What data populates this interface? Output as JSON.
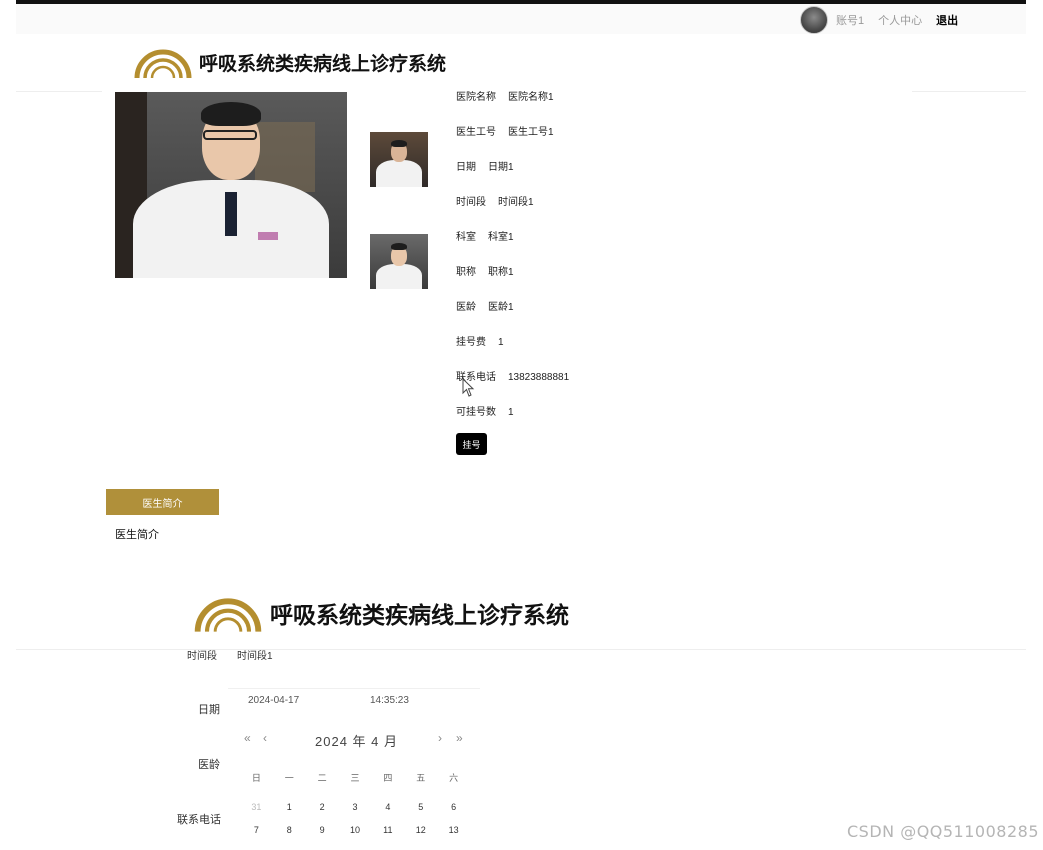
{
  "header": {
    "account": "账号1",
    "profile_link": "个人中心",
    "logout": "退出"
  },
  "brand": {
    "title": "呼吸系统类疾病线上诊疗系统"
  },
  "doctor_info": {
    "rows": [
      {
        "label": "医院名称",
        "value": "医院名称1"
      },
      {
        "label": "医生工号",
        "value": "医生工号1"
      },
      {
        "label": "日期",
        "value": "日期1"
      },
      {
        "label": "时间段",
        "value": "时间段1"
      },
      {
        "label": "科室",
        "value": "科室1"
      },
      {
        "label": "职称",
        "value": "职称1"
      },
      {
        "label": "医龄",
        "value": "医龄1"
      },
      {
        "label": "挂号费",
        "value": "1"
      },
      {
        "label": "联系电话",
        "value": "13823888881"
      },
      {
        "label": "可挂号数",
        "value": "1"
      }
    ],
    "register_button": "挂号"
  },
  "intro": {
    "tab_label": "医生简介",
    "content": "医生简介"
  },
  "form": {
    "timeslot_label": "时间段",
    "timeslot_value": "时间段1",
    "date_label": "日期",
    "age_label": "医龄",
    "phone_label": "联系电话"
  },
  "datepicker": {
    "date_input": "2024-04-17",
    "time_input": "14:35:23",
    "prev_year": "«",
    "prev_month": "‹",
    "next_month": "›",
    "next_year": "»",
    "header": "2024 年  4 月",
    "weekdays": [
      "日",
      "一",
      "二",
      "三",
      "四",
      "五",
      "六"
    ],
    "days": [
      "31",
      "1",
      "2",
      "3",
      "4",
      "5",
      "6",
      "7",
      "8",
      "9",
      "10",
      "11",
      "12",
      "13"
    ]
  },
  "watermark": "CSDN @QQ511008285"
}
